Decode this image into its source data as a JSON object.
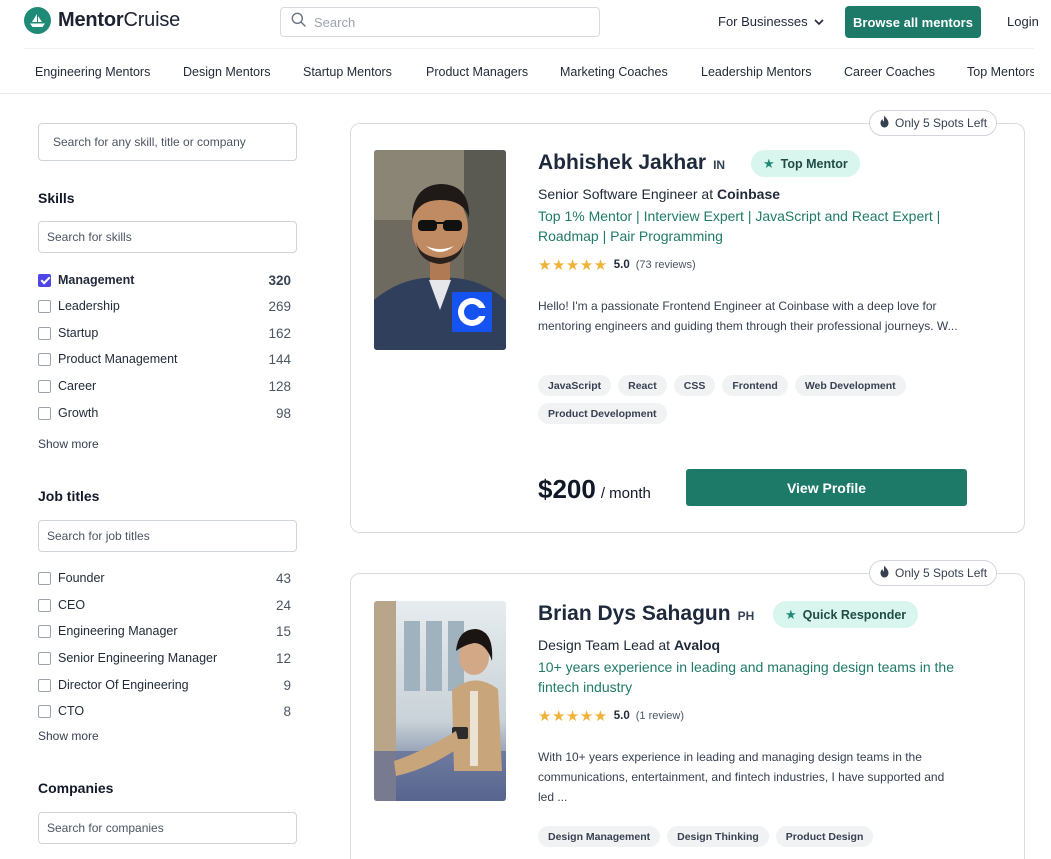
{
  "header": {
    "logo_bold": "Mentor",
    "logo_regular": "Cruise",
    "search_placeholder": "Search",
    "for_businesses": "For Businesses",
    "browse_button": "Browse all mentors",
    "login": "Login"
  },
  "category_nav": [
    "Engineering Mentors",
    "Design Mentors",
    "Startup Mentors",
    "Product Managers",
    "Marketing Coaches",
    "Leadership Mentors",
    "Career Coaches",
    "Top Mentors"
  ],
  "sidebar": {
    "main_search_placeholder": "Search for any skill, title or company",
    "skills": {
      "title": "Skills",
      "search_placeholder": "Search for skills",
      "items": [
        {
          "label": "Management",
          "count": "320",
          "checked": true
        },
        {
          "label": "Leadership",
          "count": "269",
          "checked": false
        },
        {
          "label": "Startup",
          "count": "162",
          "checked": false
        },
        {
          "label": "Product Management",
          "count": "144",
          "checked": false
        },
        {
          "label": "Career",
          "count": "128",
          "checked": false
        },
        {
          "label": "Growth",
          "count": "98",
          "checked": false
        }
      ],
      "show_more": "Show more"
    },
    "job_titles": {
      "title": "Job titles",
      "search_placeholder": "Search for job titles",
      "items": [
        {
          "label": "Founder",
          "count": "43",
          "checked": false
        },
        {
          "label": "CEO",
          "count": "24",
          "checked": false
        },
        {
          "label": "Engineering Manager",
          "count": "15",
          "checked": false
        },
        {
          "label": "Senior Engineering Manager",
          "count": "12",
          "checked": false
        },
        {
          "label": "Director Of Engineering",
          "count": "9",
          "checked": false
        },
        {
          "label": "CTO",
          "count": "8",
          "checked": false
        }
      ],
      "show_more": "Show more"
    },
    "companies": {
      "title": "Companies",
      "search_placeholder": "Search for companies"
    }
  },
  "mentors": [
    {
      "spots": "Only 5 Spots Left",
      "name": "Abhishek Jakhar",
      "country": "IN",
      "badge": "Top Mentor",
      "role_prefix": "Senior Software Engineer at ",
      "company": "Coinbase",
      "tagline": "Top 1% Mentor | Interview Expert | JavaScript and React Expert | Roadmap | Pair Programming",
      "rating": "5.0",
      "reviews": "(73 reviews)",
      "bio": "Hello! I'm a passionate Frontend Engineer at Coinbase with a deep love for mentoring engineers and guiding them through their professional journeys. W...",
      "tags": [
        "JavaScript",
        "React",
        "CSS",
        "Frontend",
        "Web Development",
        "Product Development"
      ],
      "price": "$200",
      "per": "/ month",
      "cta": "View Profile"
    },
    {
      "spots": "Only 5 Spots Left",
      "name": "Brian Dys Sahagun",
      "country": "PH",
      "badge": "Quick Responder",
      "role_prefix": "Design Team Lead at ",
      "company": "Avaloq",
      "tagline": "10+ years experience in leading and managing design teams in the fintech industry",
      "rating": "5.0",
      "reviews": "(1 review)",
      "bio": "With 10+ years experience in leading and managing design teams in the communications, entertainment, and fintech industries, I have supported and led ...",
      "tags": [
        "Design Management",
        "Design Thinking",
        "Product Design"
      ]
    }
  ],
  "colors": {
    "brand_green": "#1d7a69",
    "badge_bg": "#d8f5ee",
    "checkbox_checked": "#4f46e5",
    "star": "#f0b33a"
  }
}
